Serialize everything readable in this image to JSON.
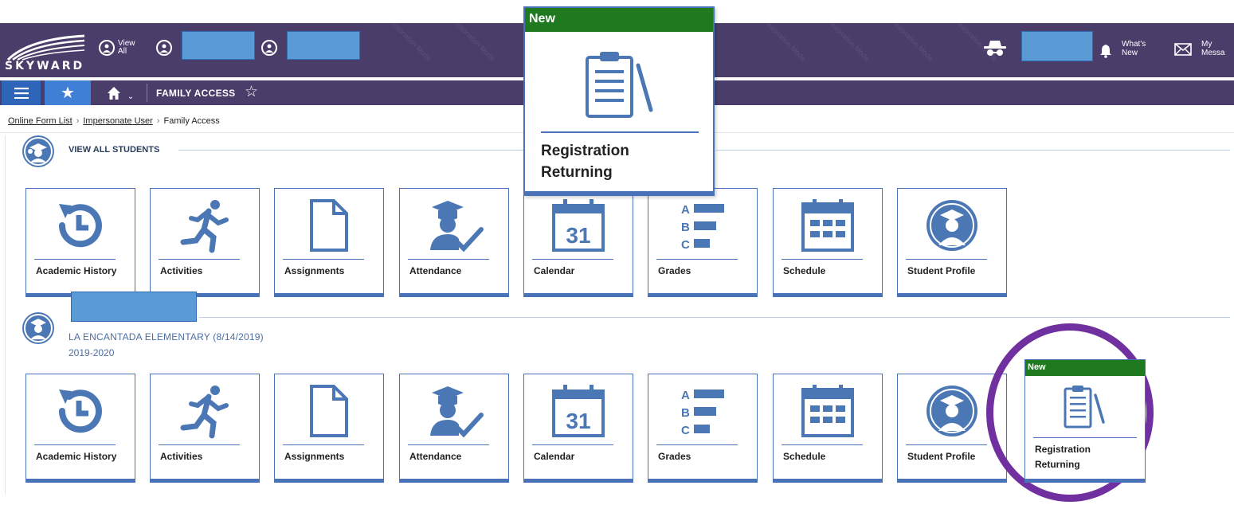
{
  "colors": {
    "header_purple": "#4a3d6a",
    "tile_blue": "#4a72b8",
    "icon_blue": "#4b78b5",
    "new_badge_green": "#1f7a1f",
    "highlight_ring_purple": "#7030a0",
    "redaction_blue": "#5b9bd5"
  },
  "header": {
    "logo_text": "SKYWARD",
    "view_all_line1": "View",
    "view_all_line2": "All",
    "whats_new_line1": "What's",
    "whats_new_line2": "New",
    "messages_line1": "My",
    "messages_line2": "Messa",
    "watermark": "Impersonation Mode"
  },
  "nav": {
    "menu_icon": "hamburger-icon",
    "favorites_icon": "star-icon",
    "home_icon": "home-icon",
    "title": "FAMILY ACCESS",
    "favorite_toggle_icon": "star-outline-icon"
  },
  "breadcrumb": {
    "items": [
      "Online Form List",
      "Impersonate User",
      "Family Access"
    ]
  },
  "all_students": {
    "title": "VIEW ALL STUDENTS",
    "tiles": [
      {
        "label": "Academic History",
        "icon": "history-icon"
      },
      {
        "label": "Activities",
        "icon": "running-icon"
      },
      {
        "label": "Assignments",
        "icon": "document-icon"
      },
      {
        "label": "Attendance",
        "icon": "graduate-check-icon"
      },
      {
        "label": "Calendar",
        "icon": "calendar-icon"
      },
      {
        "label": "Grades",
        "icon": "grades-icon"
      },
      {
        "label": "Schedule",
        "icon": "schedule-icon"
      },
      {
        "label": "Student Profile",
        "icon": "student-avatar-icon"
      }
    ]
  },
  "student": {
    "school": "LA ENCANTADA ELEMENTARY (8/14/2019)",
    "year": "2019-2020",
    "tiles": [
      {
        "label": "Academic History",
        "icon": "history-icon"
      },
      {
        "label": "Activities",
        "icon": "running-icon"
      },
      {
        "label": "Assignments",
        "icon": "document-icon"
      },
      {
        "label": "Attendance",
        "icon": "graduate-check-icon"
      },
      {
        "label": "Calendar",
        "icon": "calendar-icon"
      },
      {
        "label": "Grades",
        "icon": "grades-icon"
      },
      {
        "label": "Schedule",
        "icon": "schedule-icon"
      },
      {
        "label": "Student Profile",
        "icon": "student-avatar-icon"
      }
    ]
  },
  "calendar_day": "31",
  "grade_letters": [
    "A",
    "B",
    "C"
  ],
  "registration_popup": {
    "badge": "New",
    "line1": "Registration",
    "line2": "Returning",
    "icon": "clipboard-icon"
  },
  "registration_tile": {
    "badge": "New",
    "line1": "Registration",
    "line2": "Returning",
    "icon": "clipboard-icon"
  }
}
